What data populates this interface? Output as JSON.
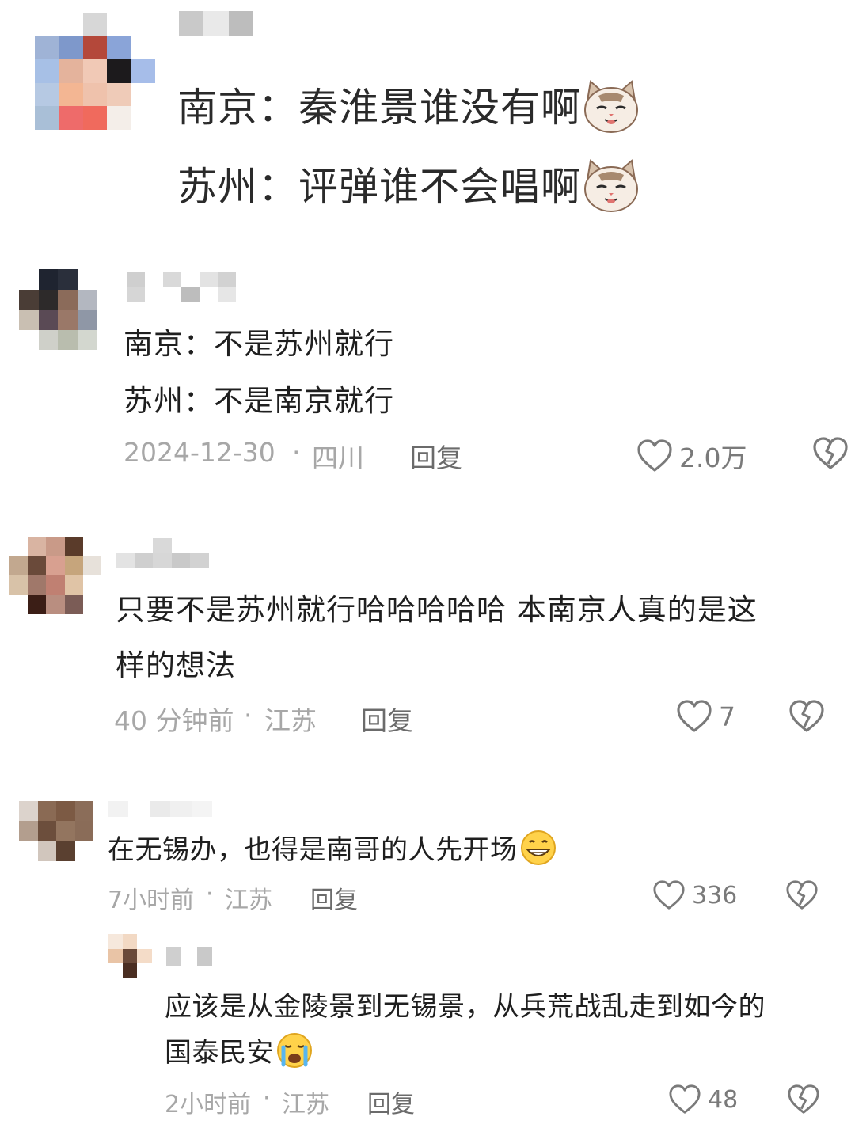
{
  "post": {
    "lines": [
      {
        "prefix": "南京：",
        "text": "秦淮景谁没有啊",
        "emoji": "cat-smirk"
      },
      {
        "prefix": "苏州：",
        "text": "评弹谁不会唱啊",
        "emoji": "cat-smirk"
      }
    ]
  },
  "comments": [
    {
      "lines": [
        "南京：不是苏州就行",
        "苏州：不是南京就行"
      ],
      "time": "2024-12-30",
      "sep": "·",
      "location": "四川",
      "reply": "回复",
      "likes": "2.0万"
    },
    {
      "lines": [
        "只要不是苏州就行哈哈哈哈哈 本南京人真的是这",
        "样的想法"
      ],
      "time": "40 分钟前",
      "sep": "·",
      "location": "江苏",
      "reply": "回复",
      "likes": "7"
    },
    {
      "lines": [
        "在无锡办，也得是南哥的人先开场"
      ],
      "emoji": "grin-face",
      "time": "7小时前",
      "sep": "·",
      "location": "江苏",
      "reply": "回复",
      "likes": "336"
    },
    {
      "lines": [
        "应该是从金陵景到无锡景，从兵荒战乱走到如今的",
        "国泰民安"
      ],
      "emoji": "crying-face",
      "time": "2小时前",
      "sep": "·",
      "location": "江苏",
      "reply": "回复",
      "likes": "48"
    }
  ],
  "colors": {
    "text": "#1f1f1f",
    "meta": "#a7a7a7",
    "reply": "#6b6b6b",
    "icon": "#7a7a7a"
  }
}
